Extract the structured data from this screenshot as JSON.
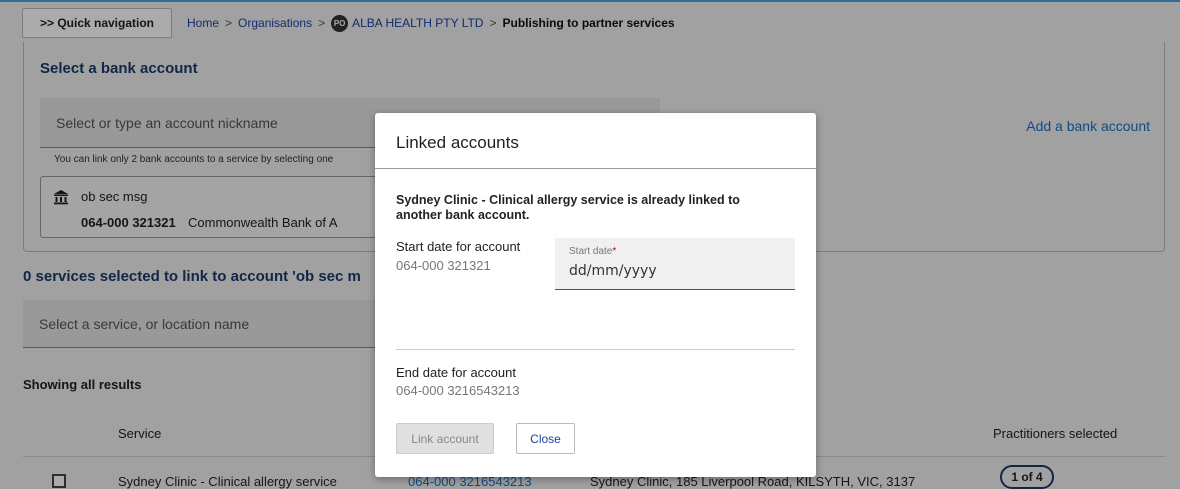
{
  "topbar": {
    "quick_nav_label": ">> Quick navigation",
    "breadcrumb": {
      "home": "Home",
      "organisations": "Organisations",
      "org_badge": "PO",
      "org_name": "ALBA HEALTH PTY LTD",
      "current": "Publishing to partner services",
      "separator": ">"
    }
  },
  "bank_section": {
    "title": "Select a bank account",
    "input_placeholder": "Select or type an account nickname",
    "helper_text": "You can link only 2 bank accounts to a service by selecting one",
    "add_link": "Add a bank account",
    "account": {
      "nickname": "ob sec msg",
      "number": "064-000 321321",
      "bank": "Commonwealth Bank of A"
    }
  },
  "services_section": {
    "title": "0 services selected to link to account 'ob sec m",
    "search_placeholder": "Select a service, or location name",
    "showing": "Showing all results",
    "columns": {
      "service": "Service",
      "practitioners": "Practitioners selected"
    },
    "rows": [
      {
        "service": "Sydney Clinic - Clinical allergy service",
        "account": "064-000 3216543213",
        "location": "Sydney Clinic, 185 Liverpool Road, KILSYTH, VIC, 3137",
        "practitioners": "1 of 4"
      }
    ]
  },
  "modal": {
    "title": "Linked accounts",
    "message": "Sydney Clinic - Clinical allergy service is already linked to another bank account.",
    "start_label": "Start date for account",
    "start_account": "064-000 321321",
    "date_field_label": "Start date",
    "date_required_mark": "*",
    "date_placeholder": "dd/mm/yyyy",
    "end_label": "End date for account",
    "end_account": "064-000 3216543213",
    "link_button": "Link account",
    "close_button": "Close"
  }
}
